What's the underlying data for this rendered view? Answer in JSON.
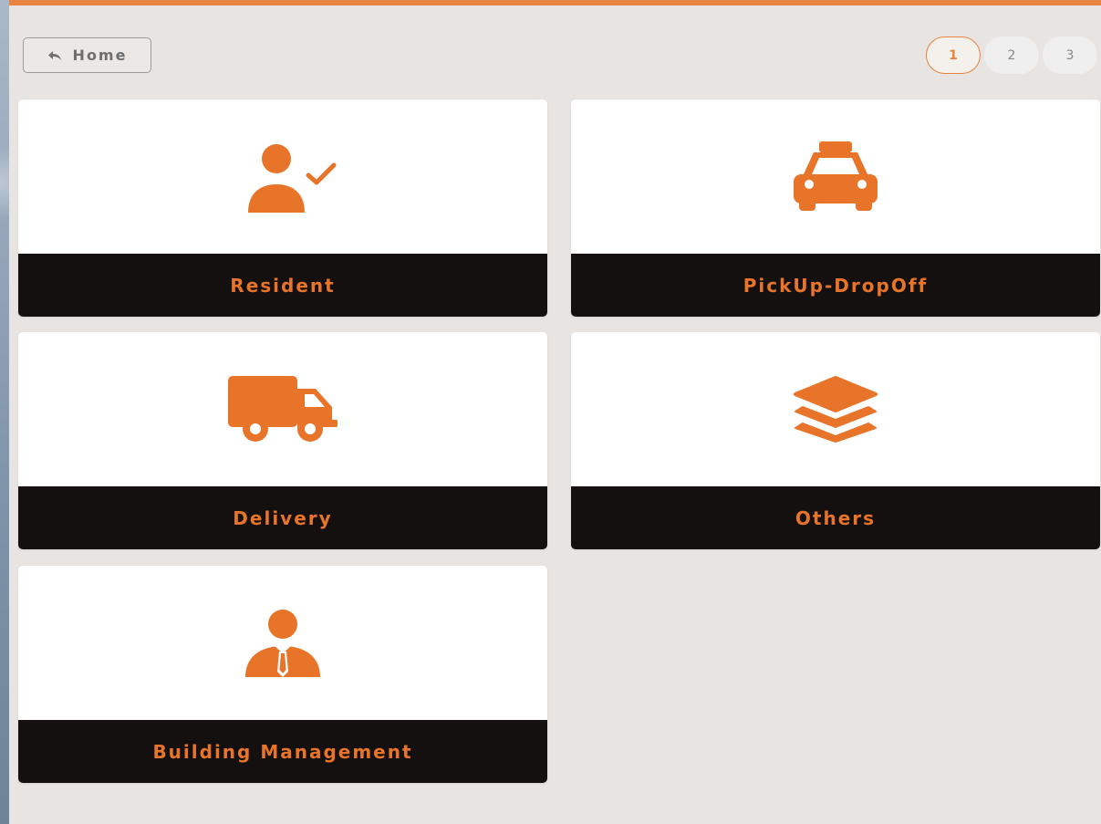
{
  "nav": {
    "home_label": "Home",
    "home_icon": "reply-arrow-icon"
  },
  "pagination": {
    "pages": [
      "1",
      "2",
      "3"
    ],
    "current": "1"
  },
  "colors": {
    "accent": "#e8742a",
    "label_bar": "#141010",
    "panel_bg": "#e8e4e1"
  },
  "categories": [
    {
      "label": "Resident",
      "icon": "user-check-icon"
    },
    {
      "label": "PickUp-DropOff",
      "icon": "taxi-icon"
    },
    {
      "label": "Delivery",
      "icon": "truck-icon"
    },
    {
      "label": "Others",
      "icon": "layers-icon"
    },
    {
      "label": "Building Management",
      "icon": "user-tie-icon"
    }
  ]
}
